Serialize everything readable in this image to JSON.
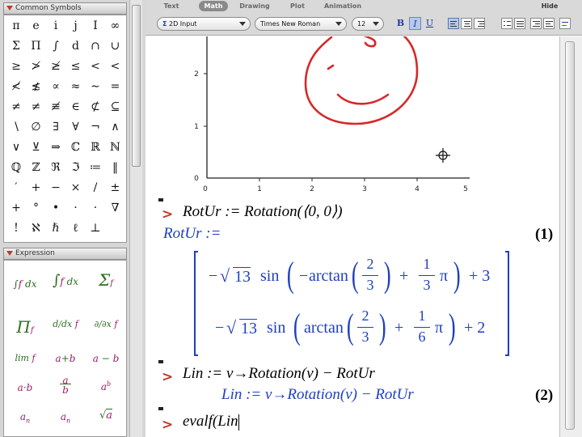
{
  "palettes": {
    "common_symbols": {
      "title": "Common Symbols",
      "symbols": [
        "π",
        "e",
        "i",
        "j",
        "I",
        "∞",
        "Σ",
        "Π",
        "∫",
        "d",
        "∩",
        "∪",
        "≥",
        "≯",
        "≱",
        "≤",
        "<",
        "<",
        "≮",
        "≴",
        "∝",
        "≈",
        "∼",
        "=",
        "≠",
        "≠",
        "≢",
        "∈",
        "⊄",
        "⊆",
        "∖",
        "∅",
        "∃",
        "∀",
        "¬",
        "∧",
        "∨",
        "⊻",
        "⇒",
        "ℂ",
        "ℝ",
        "ℕ",
        "ℚ",
        "ℤ",
        "ℜ",
        "ℑ",
        "≔",
        "‖",
        "′",
        "+",
        "−",
        "×",
        "/",
        "±",
        "+",
        "°",
        "•",
        "·",
        "·",
        "∇",
        "!",
        "ℵ",
        "ℏ",
        "ℓ",
        "⊥",
        ""
      ]
    },
    "expression": {
      "title": "Expression",
      "items": [
        "∫ f dx",
        "∫ₐᵇ f dx",
        "Σᵢ₌ₖⁿ f",
        "Πᵢ₌ₖⁿ f",
        "d/dx f",
        "∂/∂x f",
        "lim f",
        "a+b",
        "a − b",
        "a·b",
        "a/b",
        "aᵇ",
        "aₙ",
        "aₙ",
        "√a"
      ]
    }
  },
  "toolbar": {
    "tabs": [
      "Text",
      "Math",
      "Drawing",
      "Plot",
      "Animation"
    ],
    "active_tab": "Math",
    "hide_label": "Hide",
    "input_mode": "2D Input",
    "font": "Times New Roman",
    "size": "12",
    "bold": "B",
    "italic": "I",
    "underline": "U"
  },
  "plot": {
    "x_ticks": [
      "0",
      "1",
      "2",
      "3",
      "4",
      "5"
    ],
    "y_ticks": [
      "0",
      "1",
      "2"
    ],
    "sketch_color": "#d62828"
  },
  "doc": {
    "input1": "RotUr := Rotation(⟨0, 0⟩)",
    "output1_label": "RotUr :=",
    "eq1": "(1)",
    "row1": {
      "sign": "−",
      "rad": "13",
      "sin": "sin",
      "inner_sign": "−",
      "arctan": "arctan",
      "frac_a": [
        "2",
        "3"
      ],
      "plus": "+",
      "frac_b": [
        "1",
        "3"
      ],
      "pi": "π",
      "tail": "+ 3"
    },
    "row2": {
      "sign": "−",
      "rad": "13",
      "sin": "sin",
      "arctan": "arctan",
      "frac_a": [
        "2",
        "3"
      ],
      "plus": "+",
      "frac_b": [
        "1",
        "6"
      ],
      "pi": "π",
      "tail": "+ 2"
    },
    "input2": "Lin := v→Rotation(v) − RotUr",
    "output2": "Lin := v→Rotation(v) − RotUr",
    "eq2": "(2)",
    "input3": "evalf(Lin"
  },
  "colors": {
    "prompt": "#c0392b",
    "output": "#1f3fbf",
    "ink": "#d62828"
  }
}
